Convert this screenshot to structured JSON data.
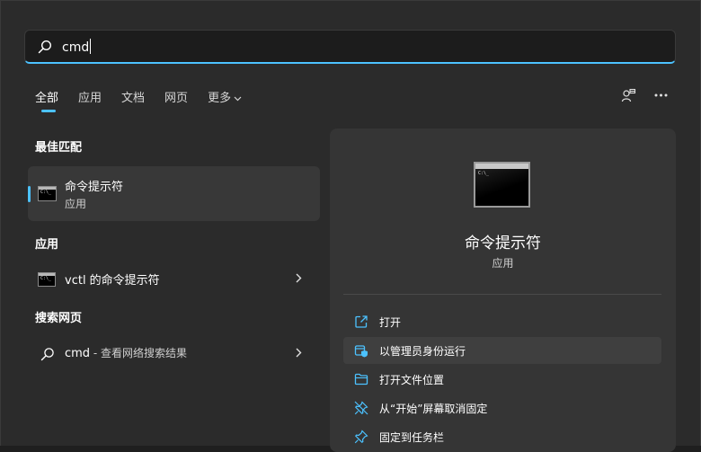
{
  "search": {
    "query": "cmd"
  },
  "tabs": [
    {
      "label": "全部",
      "active": true
    },
    {
      "label": "应用"
    },
    {
      "label": "文档"
    },
    {
      "label": "网页"
    },
    {
      "label": "更多"
    }
  ],
  "sections": {
    "best_match": "最佳匹配",
    "apps": "应用",
    "web": "搜索网页"
  },
  "best_match": {
    "name": "命令提示符",
    "type": "应用"
  },
  "apps": [
    {
      "name": "vctl 的命令提示符"
    }
  ],
  "web": {
    "query": "cmd",
    "suffix": " - 查看网络搜索结果"
  },
  "details": {
    "title": "命令提示符",
    "type": "应用",
    "actions": [
      {
        "label": "打开",
        "icon": "open-external-icon"
      },
      {
        "label": "以管理员身份运行",
        "icon": "admin-shield-icon"
      },
      {
        "label": "打开文件位置",
        "icon": "folder-icon"
      },
      {
        "label": "从“开始”屏幕取消固定",
        "icon": "unpin-icon"
      },
      {
        "label": "固定到任务栏",
        "icon": "pin-icon"
      }
    ]
  },
  "colors": {
    "accent": "#4cc2ff",
    "panel": "#2b2b2b",
    "pane": "#353535"
  }
}
